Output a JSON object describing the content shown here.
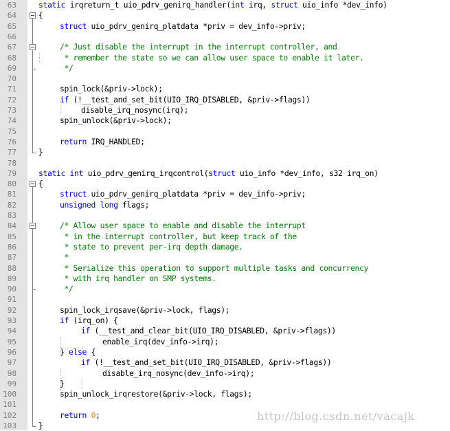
{
  "editor": {
    "lines": [
      {
        "no": "63",
        "indent": 0,
        "tokens": [
          [
            "kw",
            "static "
          ],
          [
            "",
            "irqreturn_t uio_pdrv_genirq_handler("
          ],
          [
            "kw",
            "int"
          ],
          [
            "",
            " irq, "
          ],
          [
            "kw",
            "struct"
          ],
          [
            "",
            " uio_info *dev_info)"
          ]
        ]
      },
      {
        "no": "64",
        "indent": 0,
        "tokens": [
          [
            "",
            "{"
          ]
        ]
      },
      {
        "no": "65",
        "indent": 1,
        "tokens": [
          [
            "kw",
            "struct"
          ],
          [
            "",
            " uio_pdrv_genirq_platdata *priv = dev_info->priv;"
          ]
        ]
      },
      {
        "no": "66",
        "indent": 0,
        "tokens": []
      },
      {
        "no": "67",
        "indent": 1,
        "tokens": [
          [
            "cm",
            "/* Just disable the interrupt in the interrupt controller, and"
          ]
        ]
      },
      {
        "no": "68",
        "indent": 1,
        "tokens": [
          [
            "cm",
            " * remember the state so we can allow user space to enable it later."
          ]
        ]
      },
      {
        "no": "69",
        "indent": 1,
        "tokens": [
          [
            "cm",
            " */"
          ]
        ]
      },
      {
        "no": "70",
        "indent": 0,
        "tokens": []
      },
      {
        "no": "71",
        "indent": 1,
        "tokens": [
          [
            "",
            "spin_lock(&priv->lock);"
          ]
        ]
      },
      {
        "no": "72",
        "indent": 1,
        "tokens": [
          [
            "kw",
            "if"
          ],
          [
            "",
            " (!__test_and_set_bit(UIO_IRQ_DISABLED, &priv->flags))"
          ]
        ]
      },
      {
        "no": "73",
        "indent": 2,
        "tokens": [
          [
            "",
            "disable_irq_nosync(irq);"
          ]
        ]
      },
      {
        "no": "74",
        "indent": 1,
        "tokens": [
          [
            "",
            "spin_unlock(&priv->lock);"
          ]
        ]
      },
      {
        "no": "75",
        "indent": 0,
        "tokens": []
      },
      {
        "no": "76",
        "indent": 1,
        "tokens": [
          [
            "kw",
            "return"
          ],
          [
            "",
            " IRQ_HANDLED;"
          ]
        ]
      },
      {
        "no": "77",
        "indent": 0,
        "tokens": [
          [
            "",
            "}"
          ]
        ]
      },
      {
        "no": "78",
        "indent": 0,
        "tokens": []
      },
      {
        "no": "79",
        "indent": 0,
        "tokens": [
          [
            "kw",
            "static int"
          ],
          [
            "",
            " uio_pdrv_genirq_irqcontrol("
          ],
          [
            "kw",
            "struct"
          ],
          [
            "",
            " uio_info *dev_info, s32 irq_on)"
          ]
        ]
      },
      {
        "no": "80",
        "indent": 0,
        "tokens": [
          [
            "",
            "{"
          ]
        ]
      },
      {
        "no": "81",
        "indent": 1,
        "tokens": [
          [
            "kw",
            "struct"
          ],
          [
            "",
            " uio_pdrv_genirq_platdata *priv = dev_info->priv;"
          ]
        ]
      },
      {
        "no": "82",
        "indent": 1,
        "tokens": [
          [
            "kw",
            "unsigned long"
          ],
          [
            "",
            " flags;"
          ]
        ]
      },
      {
        "no": "83",
        "indent": 0,
        "tokens": []
      },
      {
        "no": "84",
        "indent": 1,
        "tokens": [
          [
            "cm",
            "/* Allow user space to enable and disable the interrupt"
          ]
        ]
      },
      {
        "no": "85",
        "indent": 1,
        "tokens": [
          [
            "cm",
            " * in the interrupt controller, but keep track of the"
          ]
        ]
      },
      {
        "no": "86",
        "indent": 1,
        "tokens": [
          [
            "cm",
            " * state to prevent per-irq depth damage."
          ]
        ]
      },
      {
        "no": "87",
        "indent": 1,
        "tokens": [
          [
            "cm",
            " *"
          ]
        ]
      },
      {
        "no": "88",
        "indent": 1,
        "tokens": [
          [
            "cm",
            " * Serialize this operation to support multiple tasks and concurrency"
          ]
        ]
      },
      {
        "no": "89",
        "indent": 1,
        "tokens": [
          [
            "cm",
            " * with irq handler on SMP systems."
          ]
        ]
      },
      {
        "no": "90",
        "indent": 1,
        "tokens": [
          [
            "cm",
            " */"
          ]
        ]
      },
      {
        "no": "91",
        "indent": 0,
        "tokens": []
      },
      {
        "no": "92",
        "indent": 1,
        "tokens": [
          [
            "",
            "spin_lock_irqsave(&priv->lock, flags);"
          ]
        ]
      },
      {
        "no": "93",
        "indent": 1,
        "tokens": [
          [
            "kw",
            "if"
          ],
          [
            "",
            " (irq_on) {"
          ]
        ]
      },
      {
        "no": "94",
        "indent": 2,
        "tokens": [
          [
            "kw",
            "if"
          ],
          [
            "",
            " (__test_and_clear_bit(UIO_IRQ_DISABLED, &priv->flags))"
          ]
        ]
      },
      {
        "no": "95",
        "indent": 3,
        "tokens": [
          [
            "",
            "enable_irq(dev_info->irq);"
          ]
        ]
      },
      {
        "no": "96",
        "indent": 1,
        "tokens": [
          [
            "",
            "} "
          ],
          [
            "kw",
            "else"
          ],
          [
            "",
            " {"
          ]
        ]
      },
      {
        "no": "97",
        "indent": 2,
        "tokens": [
          [
            "kw",
            "if"
          ],
          [
            "",
            " (!__test_and_set_bit(UIO_IRQ_DISABLED, &priv->flags))"
          ]
        ]
      },
      {
        "no": "98",
        "indent": 3,
        "tokens": [
          [
            "",
            "disable_irq_nosync(dev_info->irq);"
          ]
        ]
      },
      {
        "no": "99",
        "indent": 1,
        "tokens": [
          [
            "",
            "}"
          ]
        ]
      },
      {
        "no": "100",
        "indent": 1,
        "tokens": [
          [
            "",
            "spin_unlock_irqrestore(&priv->lock, flags);"
          ]
        ]
      },
      {
        "no": "101",
        "indent": 0,
        "tokens": []
      },
      {
        "no": "102",
        "indent": 1,
        "tokens": [
          [
            "kw",
            "return"
          ],
          [
            "",
            " "
          ],
          [
            "num",
            "0"
          ],
          [
            "",
            ";"
          ]
        ]
      },
      {
        "no": "103",
        "indent": 0,
        "tokens": [
          [
            "",
            "}"
          ]
        ]
      }
    ]
  },
  "watermark": "http://blog.csdn.net/vacajk",
  "colors": {
    "keyword": "#0000ff",
    "comment": "#008000",
    "number": "#ff8000",
    "gutter": "#e4e4e4",
    "line_number": "#7e7e7e"
  }
}
